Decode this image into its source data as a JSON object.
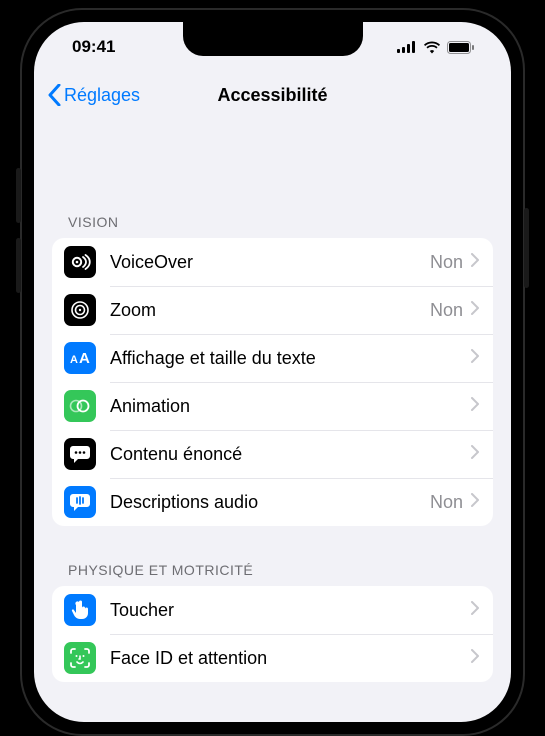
{
  "status": {
    "time": "09:41"
  },
  "nav": {
    "back": "Réglages",
    "title": "Accessibilité"
  },
  "sections": {
    "vision": {
      "header": "VISION",
      "items": [
        {
          "id": "voiceover",
          "label": "VoiceOver",
          "value": "Non",
          "color": "#000000"
        },
        {
          "id": "zoom",
          "label": "Zoom",
          "value": "Non",
          "color": "#000000"
        },
        {
          "id": "display",
          "label": "Affichage et taille du texte",
          "value": "",
          "color": "#007aff"
        },
        {
          "id": "motion",
          "label": "Animation",
          "value": "",
          "color": "#34c759"
        },
        {
          "id": "spoken",
          "label": "Contenu énoncé",
          "value": "",
          "color": "#000000"
        },
        {
          "id": "audiodesc",
          "label": "Descriptions audio",
          "value": "Non",
          "color": "#007aff"
        }
      ]
    },
    "motor": {
      "header": "PHYSIQUE ET MOTRICITÉ",
      "items": [
        {
          "id": "touch",
          "label": "Toucher",
          "value": "",
          "color": "#007aff"
        },
        {
          "id": "faceid",
          "label": "Face ID et attention",
          "value": "",
          "color": "#34c759"
        }
      ]
    }
  }
}
